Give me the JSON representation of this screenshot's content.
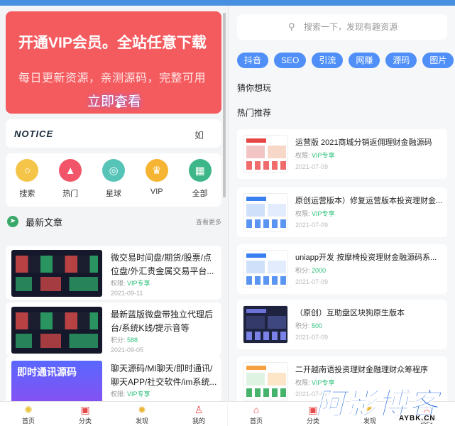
{
  "left": {
    "banner": {
      "headline": "开通VIP会员。全站任意下载",
      "subline": "每日更新资源，亲测源码，完整可用",
      "cta": "立即查看"
    },
    "notice": {
      "logo": "NOTICE",
      "text": "如"
    },
    "shortcuts": [
      {
        "label": "搜索",
        "icon": "search-icon",
        "color": "#f5c54a",
        "glyph": "○"
      },
      {
        "label": "热门",
        "icon": "flame-icon",
        "color": "#f2556a",
        "glyph": "▲"
      },
      {
        "label": "星球",
        "icon": "planet-icon",
        "color": "#57c4b8",
        "glyph": "◎"
      },
      {
        "label": "VIP",
        "icon": "crown-icon",
        "color": "#f5b431",
        "glyph": "♛"
      },
      {
        "label": "全部",
        "icon": "grid-icon",
        "color": "#3db789",
        "glyph": "▦"
      }
    ],
    "section": {
      "title": "最新文章",
      "more": "查看更多"
    },
    "articles": [
      {
        "title": "微交易时间盘/期货/股票/点位盘/外汇贵金属交易平台...",
        "meta_label": "权限:",
        "meta_value": "VIP专享",
        "date": "2021-09-11"
      },
      {
        "title": "最新蓝版微盘带独立代理后台/系统K线/提示音等",
        "meta_label": "积分:",
        "meta_value": "588",
        "date": "2021-09-05"
      },
      {
        "title": "聊天源码/MI聊天/即时通讯/聊天APP/社交软件/im系统...",
        "meta_label": "权限:",
        "meta_value": "VIP专享",
        "date": "2021-09-05",
        "thumb_title": "即时通讯源码"
      }
    ]
  },
  "right": {
    "search_placeholder": "搜索一下，发现有趣资源",
    "tags": [
      "抖音",
      "SEO",
      "引流",
      "网赚",
      "源码",
      "图片"
    ],
    "guess": "猜你想玩",
    "hot": "热门推荐",
    "cards": [
      {
        "title": "运营版 2021商城分销返佣理财金融源码",
        "meta_label": "权限:",
        "meta_value": "VIP专享",
        "date": "2021-07-09"
      },
      {
        "title": "原创运营版本）修复运营版本投资理财金...",
        "meta_label": "权限:",
        "meta_value": "VIP专享",
        "date": "2021-07-09"
      },
      {
        "title": "uniapp开发 按摩椅投资理财金融源码系...",
        "meta_label": "积分:",
        "meta_value": "2000",
        "date": "2021-07-09"
      },
      {
        "title": "（原创）互助盘区块狗原生版本",
        "meta_label": "积分:",
        "meta_value": "500",
        "date": "2021-07-09"
      },
      {
        "title": "二开越南语投资理财金融理财众筹程序",
        "meta_label": "权限:",
        "meta_value": "VIP专享",
        "date": "2021-07-09"
      }
    ]
  },
  "nav": {
    "items": [
      {
        "label": "首页",
        "icon": "home-icon"
      },
      {
        "label": "分类",
        "icon": "category-icon"
      },
      {
        "label": "发现",
        "icon": "bulb-icon"
      },
      {
        "label": "我的",
        "icon": "user-icon"
      }
    ]
  },
  "watermark": {
    "big": "阿影博客",
    "small": "AYBK.CN"
  }
}
